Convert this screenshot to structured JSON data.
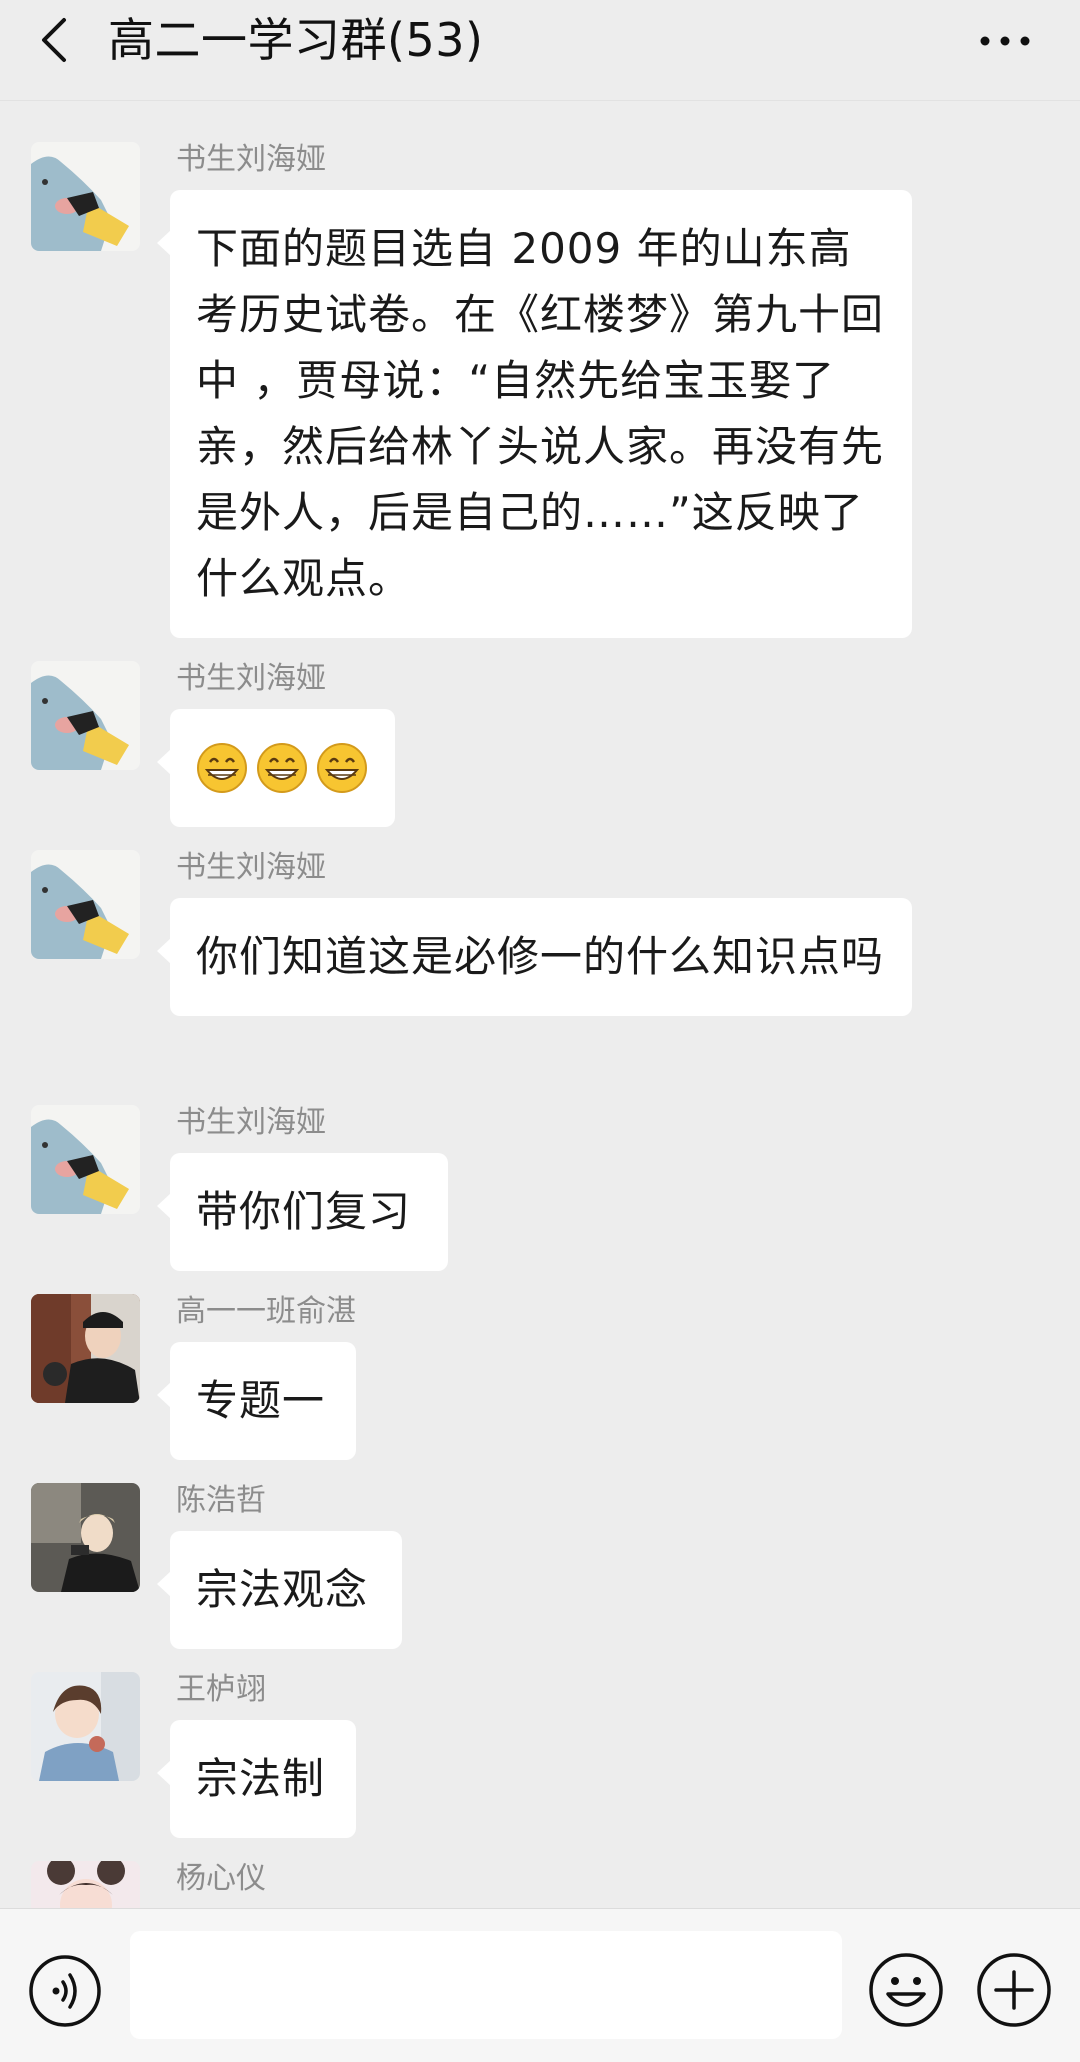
{
  "header": {
    "title": "高二一学习群(53)"
  },
  "messages": [
    {
      "sender": "书生刘海娅",
      "avatar": "cartoon-avatar",
      "text": "下面的题目选自 2009 年的山东高考历史试卷。在《红楼梦》第九十回中 ，贾母说：“自然先给宝玉娶了亲，然后给林丫头说人家。再没有先是外人，后是自己的……”这反映了什么观点。"
    },
    {
      "sender": "书生刘海娅",
      "avatar": "cartoon-avatar",
      "emojis": [
        "grin-emoji",
        "grin-emoji",
        "grin-emoji"
      ]
    },
    {
      "sender": "书生刘海娅",
      "avatar": "cartoon-avatar",
      "text": "你们知道这是必修一的什么知识点吗"
    },
    {
      "sender": "书生刘海娅",
      "avatar": "cartoon-avatar",
      "text": "带你们复习"
    },
    {
      "sender": "高一一班俞湛",
      "avatar": "photo-avatar",
      "text": "专题一"
    },
    {
      "sender": "陈浩哲",
      "avatar": "photo-avatar",
      "text": "宗法观念"
    },
    {
      "sender": "王栌翊",
      "avatar": "photo-avatar",
      "text": "宗法制"
    },
    {
      "sender": "杨心仪",
      "avatar": "photo-avatar"
    }
  ],
  "input_bar": {
    "input_value": "",
    "icons": [
      "voice-icon",
      "emoji-icon",
      "plus-icon"
    ]
  }
}
